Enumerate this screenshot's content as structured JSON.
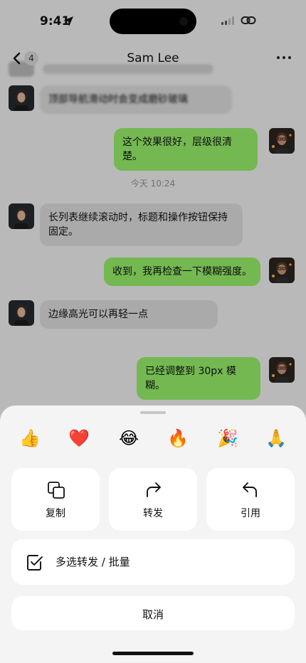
{
  "status_bar": {
    "time": "9:41"
  },
  "nav": {
    "back_count": "4",
    "title": "Sam Lee"
  },
  "messages": [
    {
      "side": "in",
      "text": "顶部导航滑动时会变成磨砂玻璃"
    },
    {
      "side": "out",
      "text": "这个效果很好，层级很清楚。"
    },
    {
      "side": "in",
      "text": "长列表继续滚动时，标题和操作按钮保持固定。"
    },
    {
      "side": "out",
      "text": "收到，我再检查一下模糊强度。"
    },
    {
      "side": "in",
      "text": "边缘高光可以再轻一点"
    },
    {
      "side": "out",
      "text": "已经调整到 30px 模糊。"
    }
  ],
  "timestamp": "今天 10:24",
  "sheet": {
    "reactions": [
      "👍",
      "❤️",
      "😂",
      "🔥",
      "🎉",
      "🙏"
    ],
    "actions": [
      {
        "label": "复制",
        "icon": "copy-icon"
      },
      {
        "label": "转发",
        "icon": "forward-icon"
      },
      {
        "label": "引用",
        "icon": "reply-icon"
      }
    ],
    "multi_select": {
      "label": "多选转发 / 批量",
      "icon": "checkbox-icon"
    },
    "cancel": "取消"
  },
  "colors": {
    "outgoing_bubble": "#95ec69",
    "incoming_bubble": "#dadada",
    "sheet_bg": "#f4f4f4"
  }
}
